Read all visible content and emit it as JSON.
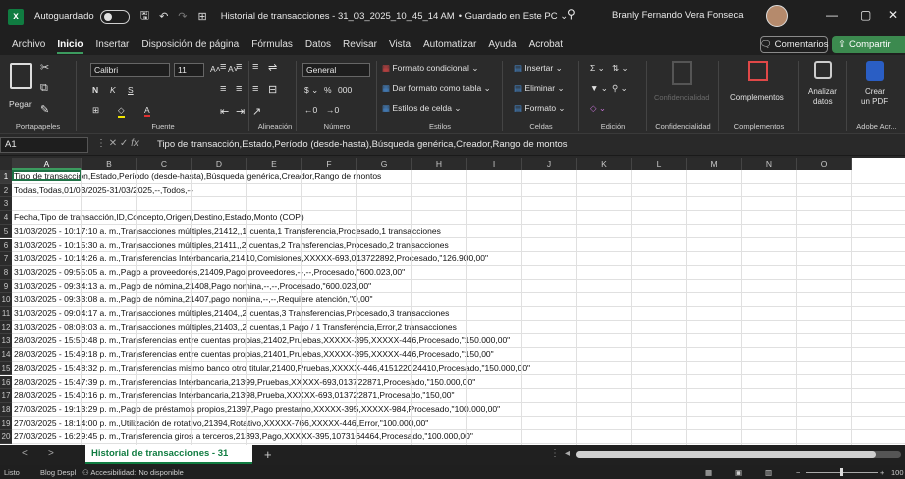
{
  "titlebar": {
    "autosave_label": "Autoguardado",
    "document_title": "Historial de transacciones - 31_03_2025_10_45_14 AM",
    "save_status": "• Guardado en Este PC ⌄",
    "user_name": "Branly Fernando Vera Fonseca"
  },
  "menu": [
    "Archivo",
    "Inicio",
    "Insertar",
    "Disposición de página",
    "Fórmulas",
    "Datos",
    "Revisar",
    "Vista",
    "Automatizar",
    "Ayuda",
    "Acrobat"
  ],
  "menu_active": "Inicio",
  "comments_label": "Comentarios",
  "share_label": "Compartir",
  "ribbon": {
    "paste_label": "Pegar",
    "group_portapapeles": "Portapapeles",
    "font_name": "Calibri",
    "font_size": "11",
    "group_fuente": "Fuente",
    "group_alineacion": "Alineación",
    "number_format": "General",
    "group_numero": "Número",
    "cond_format": "Formato condicional",
    "table_format": "Dar formato como tabla",
    "cell_styles": "Estilos de celda",
    "group_estilos": "Estilos",
    "insert": "Insertar",
    "delete": "Eliminar",
    "format": "Formato",
    "group_celdas": "Celdas",
    "group_edicion": "Edición",
    "confidencialidad_btn": "Confidencialidad",
    "group_confidencialidad": "Confidencialidad",
    "complementos_btn": "Complementos",
    "group_complementos": "Complementos",
    "analizar_l1": "Analizar",
    "analizar_l2": "datos",
    "crear_l1": "Crear",
    "crear_l2": "un PDF",
    "group_adobe": "Adobe Acr..."
  },
  "formula_bar": {
    "name_box": "A1",
    "fx": "fx",
    "content": "Tipo de transacción,Estado,Período (desde-hasta),Búsqueda genérica,Creador,Rango de montos"
  },
  "columns": [
    "A",
    "B",
    "C",
    "D",
    "E",
    "F",
    "G",
    "H",
    "I",
    "J",
    "K",
    "L",
    "M",
    "N",
    "O"
  ],
  "rows": [
    "Tipo de transacción,Estado,Período (desde-hasta),Búsqueda genérica,Creador,Rango de montos",
    "Todas,Todas,01/03/2025-31/03/2025,--,Todos,--",
    "",
    "Fecha,Tipo de transacción,ID,Concepto,Origen,Destino,Estado,Monto (COP)",
    "31/03/2025 - 10:17:10 a. m.,Transacciones múltiples,21412,,1 cuenta,1 Transferencia,Procesado,1 transacciones",
    "31/03/2025 - 10:15:30 a. m.,Transacciones múltiples,21411,,2 cuentas,2 Transferencias,Procesado,2 transacciones",
    "31/03/2025 - 10:14:26 a. m.,Transferencias Interbancaria,21410,Comisiones,XXXXX-693,013722892,Procesado,\"126.900,00\"",
    "31/03/2025 - 09:55:05 a. m.,Pago a proveedores,21409,Pago proveedores,--,--,Procesado,\"600.023,00\"",
    "31/03/2025 - 09:34:13 a. m.,Pago de nómina,21408,Pago nomina,--,--,Procesado,\"600.023,00\"",
    "31/03/2025 - 09:33:08 a. m.,Pago de nómina,21407,pago nomina,--,--,Requiere atención,\"0,00\"",
    "31/03/2025 - 09:04:17 a. m.,Transacciones múltiples,21404,,2 cuentas,3 Transferencias,Procesado,3 transacciones",
    "31/03/2025 - 08:08:03 a. m.,Transacciones múltiples,21403,,2 cuentas,1 Pago / 1 Transferencia,Error,2 transacciones",
    "28/03/2025 - 15:50:48 p. m.,Transferencias entre cuentas propias,21402,Pruebas,XXXXX-395,XXXXX-446,Procesado,\"150.000,00\"",
    "28/03/2025 - 15:49:18 p. m.,Transferencias entre cuentas propias,21401,Pruebas,XXXXX-395,XXXXX-446,Procesado,\"150,00\"",
    "28/03/2025 - 15:48:32 p. m.,Transferencias mismo banco otro titular,21400,Pruebas,XXXXX-446,415122024410,Procesado,\"150.000,00\"",
    "28/03/2025 - 15:47:39 p. m.,Transferencias Interbancaria,21399,Pruebas,XXXXX-693,013722871,Procesado,\"150.000,00\"",
    "28/03/2025 - 15:40:16 p. m.,Transferencias Interbancaria,21398,Prueba,XXXXX-693,013722871,Procesado,\"150,00\"",
    "27/03/2025 - 19:13:29 p. m.,Pago de préstamos propios,21397,Pago prestamo,XXXXX-395,XXXXX-984,Procesado,\"100.000,00\"",
    "27/03/2025 - 18:14:00 p. m.,Utilización de rotativo,21394,Rotativo,XXXXX-766,XXXXX-446,Error,\"100.000,00\"",
    "27/03/2025 - 16:29:45 p. m.,Transferencia giros a terceros,21393,Pago,XXXXX-395,1073164464,Procesado,\"100.000,00\""
  ],
  "sheet_tab": "Historial de transacciones - 31",
  "status": {
    "ready": "Listo",
    "blog": "Blog Despl",
    "accessibility": "Accesibilidad: No disponible",
    "zoom": "100"
  }
}
